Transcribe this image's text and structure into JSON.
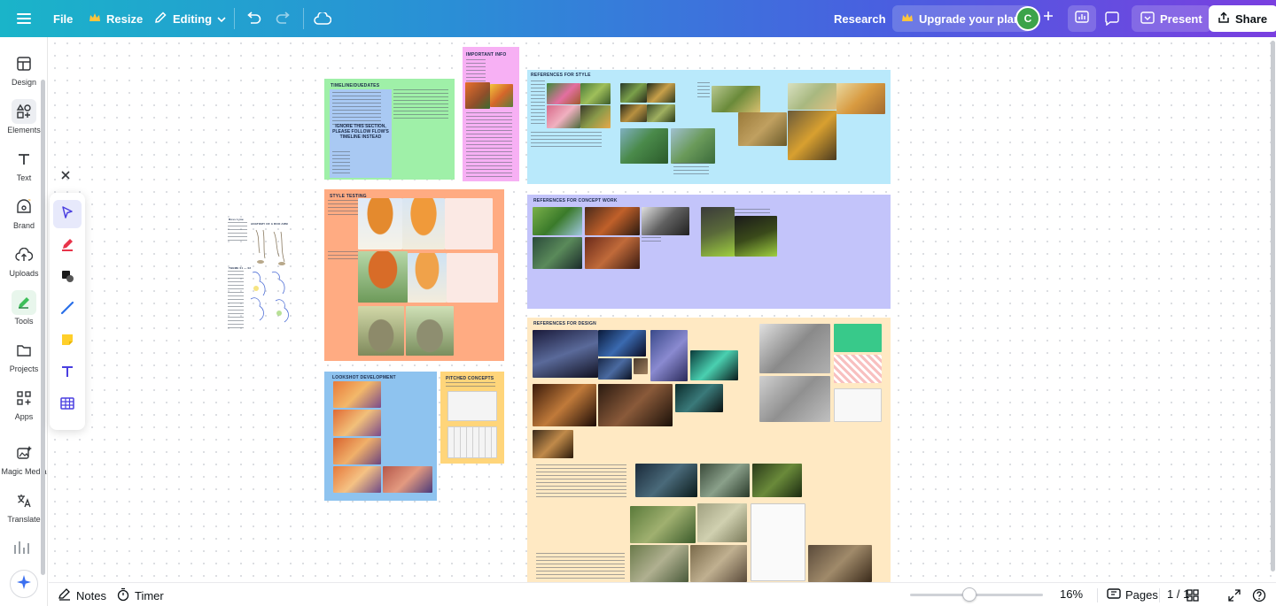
{
  "topbar": {
    "file_label": "File",
    "resize_label": "Resize",
    "editing_label": "Editing",
    "research_label": "Research",
    "upgrade_label": "Upgrade your plan",
    "avatar_initial": "C",
    "present_label": "Present",
    "share_label": "Share"
  },
  "sidebar": {
    "items": [
      {
        "label": "Design",
        "icon": "layout-icon"
      },
      {
        "label": "Elements",
        "icon": "shapes-icon"
      },
      {
        "label": "Text",
        "icon": "text-icon"
      },
      {
        "label": "Brand",
        "icon": "crown-icon"
      },
      {
        "label": "Uploads",
        "icon": "cloud-upload-icon"
      },
      {
        "label": "Tools",
        "icon": "pen-tool-icon"
      },
      {
        "label": "Projects",
        "icon": "folder-icon"
      },
      {
        "label": "Apps",
        "icon": "grid-plus-icon"
      },
      {
        "label": "Magic Media",
        "icon": "magic-media-icon"
      },
      {
        "label": "Translate",
        "icon": "translate-icon"
      }
    ]
  },
  "canvas": {
    "sections": {
      "important": "IMPORTANT INFO",
      "timeline": "TIMELINE/DUEDATES",
      "ignore_note": "IGNORE THIS SECTION, PLEASE FOLLOW FLOW'S TIMELINE INSTEAD",
      "style_testing": "STYLE TESTING",
      "lookshot": "LOOKSHOT DEVELOPMENT",
      "pitched": "PITCHED CONCEPTS",
      "ref_style": "REFERENCES FOR STYLE",
      "ref_concept": "REFERENCES FOR CONCEPT WORK",
      "ref_design": "REFERENCES FOR DESIGN",
      "anatomy": "ANATOMY OF A ROO ARM",
      "theme": "THEME 01 — 02"
    }
  },
  "bottombar": {
    "notes_label": "Notes",
    "timer_label": "Timer",
    "zoom_value": "16%",
    "pages_label": "Pages",
    "page_indicator": "1 / 1"
  },
  "colors": {
    "accent": "#7d2ae8",
    "green_section": "#9ff0a8",
    "pink_section": "#f7b0f4",
    "orange_section": "#ffab82",
    "blue_section": "#8ec3ef",
    "yellow_section": "#ffd57a",
    "cyan_section": "#b9e9fb",
    "lavender_section": "#c3c4fa",
    "cream_section": "#ffe9c3"
  }
}
